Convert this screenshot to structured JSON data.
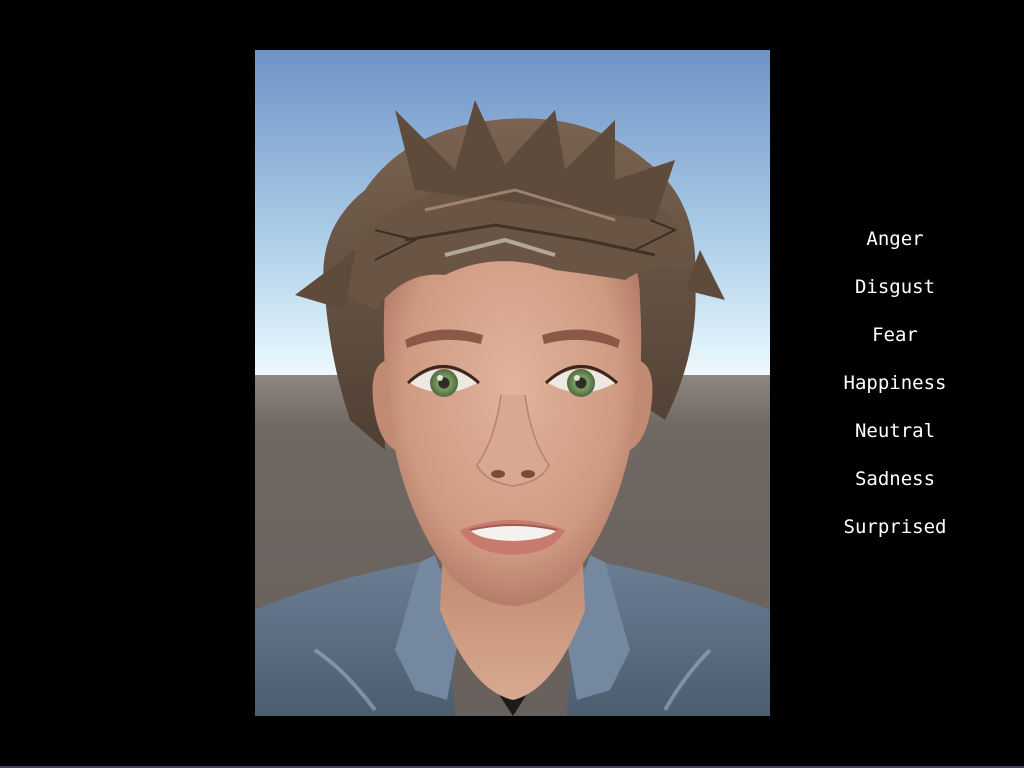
{
  "scene": {
    "colors": {
      "sky_top": "#6f92c6",
      "sky_horizon": "#dff2fb",
      "ground": "#6c6560",
      "skin": "#d49e86",
      "hair": "#6b5544",
      "jacket": "#5d6f85",
      "iris": "#6f8e5a"
    }
  },
  "menu": {
    "items": [
      {
        "label": "Anger"
      },
      {
        "label": "Disgust"
      },
      {
        "label": "Fear"
      },
      {
        "label": "Happiness"
      },
      {
        "label": "Neutral"
      },
      {
        "label": "Sadness"
      },
      {
        "label": "Surprised"
      }
    ],
    "text_color": "#ffffff"
  }
}
